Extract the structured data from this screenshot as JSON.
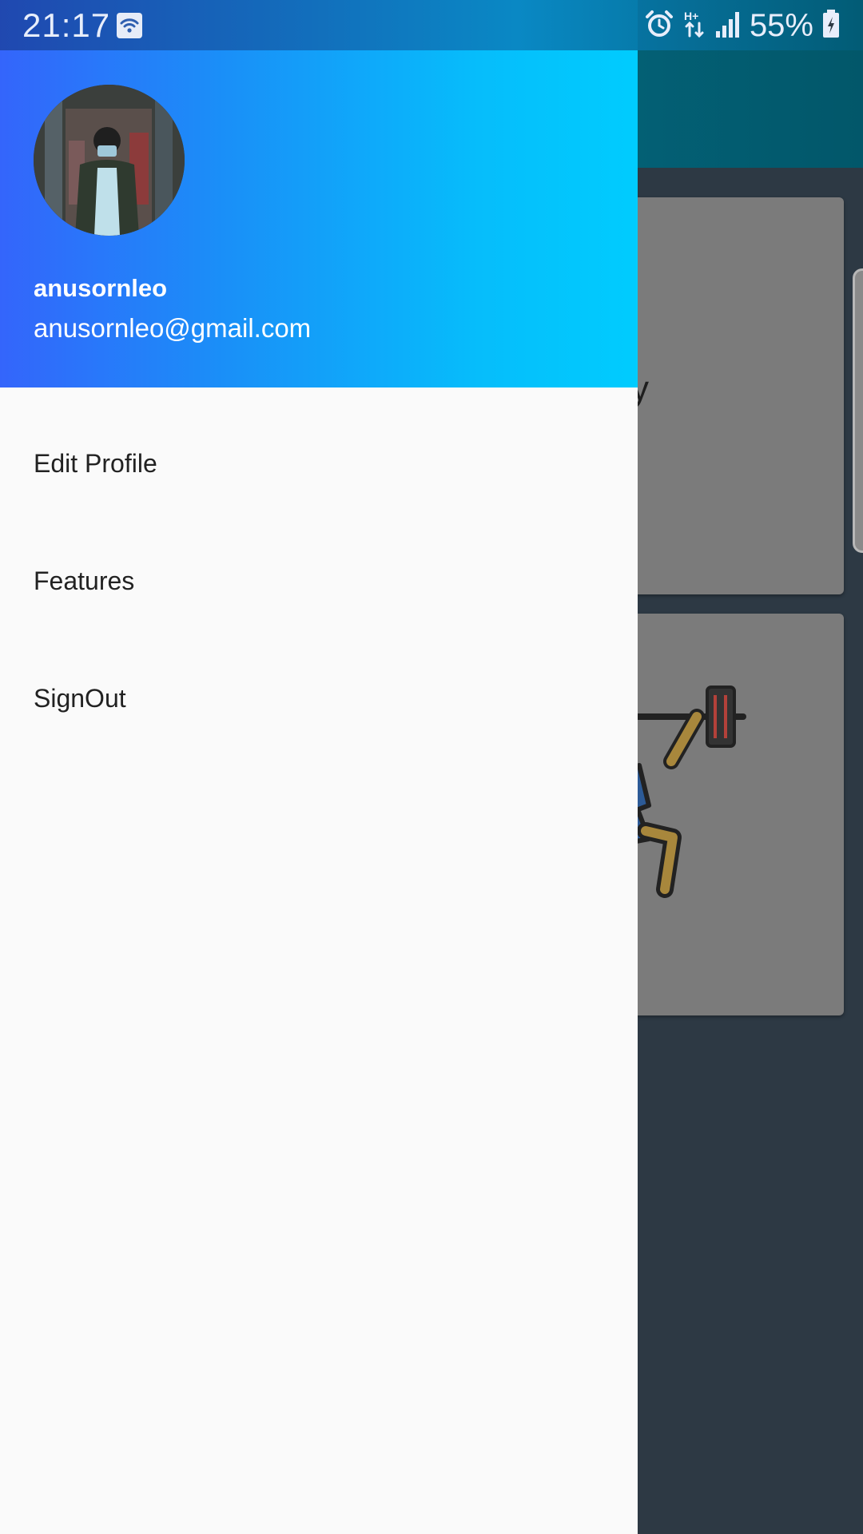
{
  "status_bar": {
    "time": "21:17",
    "battery_percent": "55%",
    "icons": [
      "wifi-icon",
      "alarm-icon",
      "hplus-data-icon",
      "signal-icon",
      "battery-charging-icon"
    ]
  },
  "drawer": {
    "user": {
      "name": "anusornleo",
      "email": "anusornleo@gmail.com",
      "avatar": "profile-photo"
    },
    "menu": [
      {
        "label": "Edit Profile"
      },
      {
        "label": "Features"
      },
      {
        "label": "SignOut"
      }
    ]
  },
  "background": {
    "card_text_fragment": "y",
    "card_illustration": "weightlifter-icon"
  },
  "colors": {
    "header_gradient_start": "#3465fb",
    "header_gradient_end": "#00ccfe",
    "drawer_background": "#fafafa",
    "app_background": "#2d3944",
    "app_bar": "#036176"
  }
}
